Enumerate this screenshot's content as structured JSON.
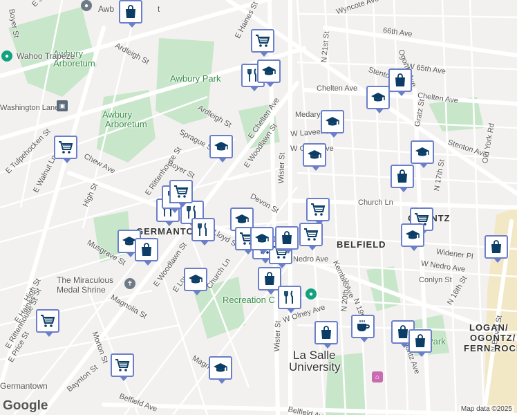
{
  "map": {
    "colors": {
      "background": "#f2f1ef",
      "park": "#c8e6c9",
      "road": "#ffffff",
      "pin_border": "#6b7fc9",
      "pin_icon": "#0b3d66"
    },
    "street_labels": [
      {
        "text": "Boyer St"
      },
      {
        "text": "E Johnson St"
      },
      {
        "text": "Ardleigh St"
      },
      {
        "text": "E Haines St"
      },
      {
        "text": "Wyncote Ave"
      },
      {
        "text": "66th Ave"
      },
      {
        "text": "W 65th Ave"
      },
      {
        "text": "Stenton Ave"
      },
      {
        "text": "Chelten Ave"
      },
      {
        "text": "Chelten Ave"
      },
      {
        "text": "N 21st St"
      },
      {
        "text": "Ogontz Ave"
      },
      {
        "text": "Medary Ave"
      },
      {
        "text": "W Laveer St"
      },
      {
        "text": "W Chew Ave"
      },
      {
        "text": "Stenton Ave"
      },
      {
        "text": "Gratz St"
      },
      {
        "text": "Old York Rd"
      },
      {
        "text": "E Chelten Ave"
      },
      {
        "text": "Ardleigh St"
      },
      {
        "text": "Sprague St"
      },
      {
        "text": "E Woodlawn St"
      },
      {
        "text": "E Woodlawn St"
      },
      {
        "text": "Wister St"
      },
      {
        "text": "E Rittenhouse St"
      },
      {
        "text": "Boyer St"
      },
      {
        "text": "E Tulpehocken St"
      },
      {
        "text": "Chew Ave"
      },
      {
        "text": "High St"
      },
      {
        "text": "E Walnut Ln"
      },
      {
        "text": "Devon St"
      },
      {
        "text": "Church Ln"
      },
      {
        "text": "N 17th St"
      },
      {
        "text": "Widener Pl"
      },
      {
        "text": "W Nedro Ave"
      },
      {
        "text": "Conlyn St"
      },
      {
        "text": "Nedro Ave"
      },
      {
        "text": "Kemble Ave"
      },
      {
        "text": "Musgrave St"
      },
      {
        "text": "E Woodlawn St"
      },
      {
        "text": "High St"
      },
      {
        "text": "E Haines St"
      },
      {
        "text": "Church Ln"
      },
      {
        "text": "Magnolia St"
      },
      {
        "text": "W Olney Ave"
      },
      {
        "text": "N 20th St"
      },
      {
        "text": "N 19th St"
      },
      {
        "text": "N 16th St"
      },
      {
        "text": "Ogontz Ave"
      },
      {
        "text": "N Broad St"
      },
      {
        "text": "E Rittenhouse St"
      },
      {
        "text": "E Price St"
      },
      {
        "text": "Morton St"
      },
      {
        "text": "Baynton St"
      },
      {
        "text": "Wister St"
      },
      {
        "text": "Belfield Ave"
      },
      {
        "text": "Belfield Ave"
      },
      {
        "text": "Magnolia St"
      },
      {
        "text": "Washington Lane"
      },
      {
        "text": "Lloyd St"
      },
      {
        "text": "E Lou"
      }
    ],
    "park_labels": [
      {
        "text": "Awbury Park"
      },
      {
        "text": "Awbury"
      },
      {
        "text": "Arboretum"
      },
      {
        "text": "Awbury"
      },
      {
        "text": "Arboretum"
      },
      {
        "text": "Recreation C"
      },
      {
        "text": "Park"
      }
    ],
    "area_labels": [
      {
        "text": "GERMANTOWN"
      },
      {
        "text": "BELFIELD"
      },
      {
        "text": "OGONTZ"
      },
      {
        "text": "LOGAN/"
      },
      {
        "text": "OGONTZ/"
      },
      {
        "text": "FERN ROCK"
      },
      {
        "text": "Germantown"
      }
    ],
    "poi_labels": [
      {
        "text": "Wahoo Trapeze"
      },
      {
        "text": "The Miraculous"
      },
      {
        "text": "Medal Shrine"
      },
      {
        "text": "La Salle"
      },
      {
        "text": "University"
      },
      {
        "text": "Awb"
      },
      {
        "text": "t"
      }
    ],
    "pins": [
      {
        "type": "shopping-bag"
      },
      {
        "type": "grocery-cart"
      },
      {
        "type": "restaurant"
      },
      {
        "type": "graduation"
      },
      {
        "type": "shopping-bag"
      },
      {
        "type": "graduation"
      },
      {
        "type": "graduation"
      },
      {
        "type": "graduation"
      },
      {
        "type": "graduation"
      },
      {
        "type": "graduation"
      },
      {
        "type": "grocery-cart"
      },
      {
        "type": "shopping-bag"
      },
      {
        "type": "grocery-cart"
      },
      {
        "type": "graduation"
      },
      {
        "type": "grocery-cart"
      },
      {
        "type": "restaurant"
      },
      {
        "type": "restaurant"
      },
      {
        "type": "restaurant"
      },
      {
        "type": "restaurant"
      },
      {
        "type": "graduation"
      },
      {
        "type": "grocery-cart"
      },
      {
        "type": "grocery-cart"
      },
      {
        "type": "grocery-cart"
      },
      {
        "type": "shopping-bag"
      },
      {
        "type": "grocery-cart"
      },
      {
        "type": "graduation"
      },
      {
        "type": "shopping-bag"
      },
      {
        "type": "shopping-bag"
      },
      {
        "type": "restaurant"
      },
      {
        "type": "graduation"
      },
      {
        "type": "grocery-cart"
      },
      {
        "type": "shopping-bag"
      },
      {
        "type": "coffee"
      },
      {
        "type": "shopping-bag"
      },
      {
        "type": "shopping-bag"
      },
      {
        "type": "graduation"
      },
      {
        "type": "grocery-cart"
      },
      {
        "type": "shopping-bag"
      },
      {
        "type": "graduation"
      },
      {
        "type": "grocery-cart"
      }
    ],
    "google_logo": "Google",
    "attribution": "Map data ©2025"
  }
}
